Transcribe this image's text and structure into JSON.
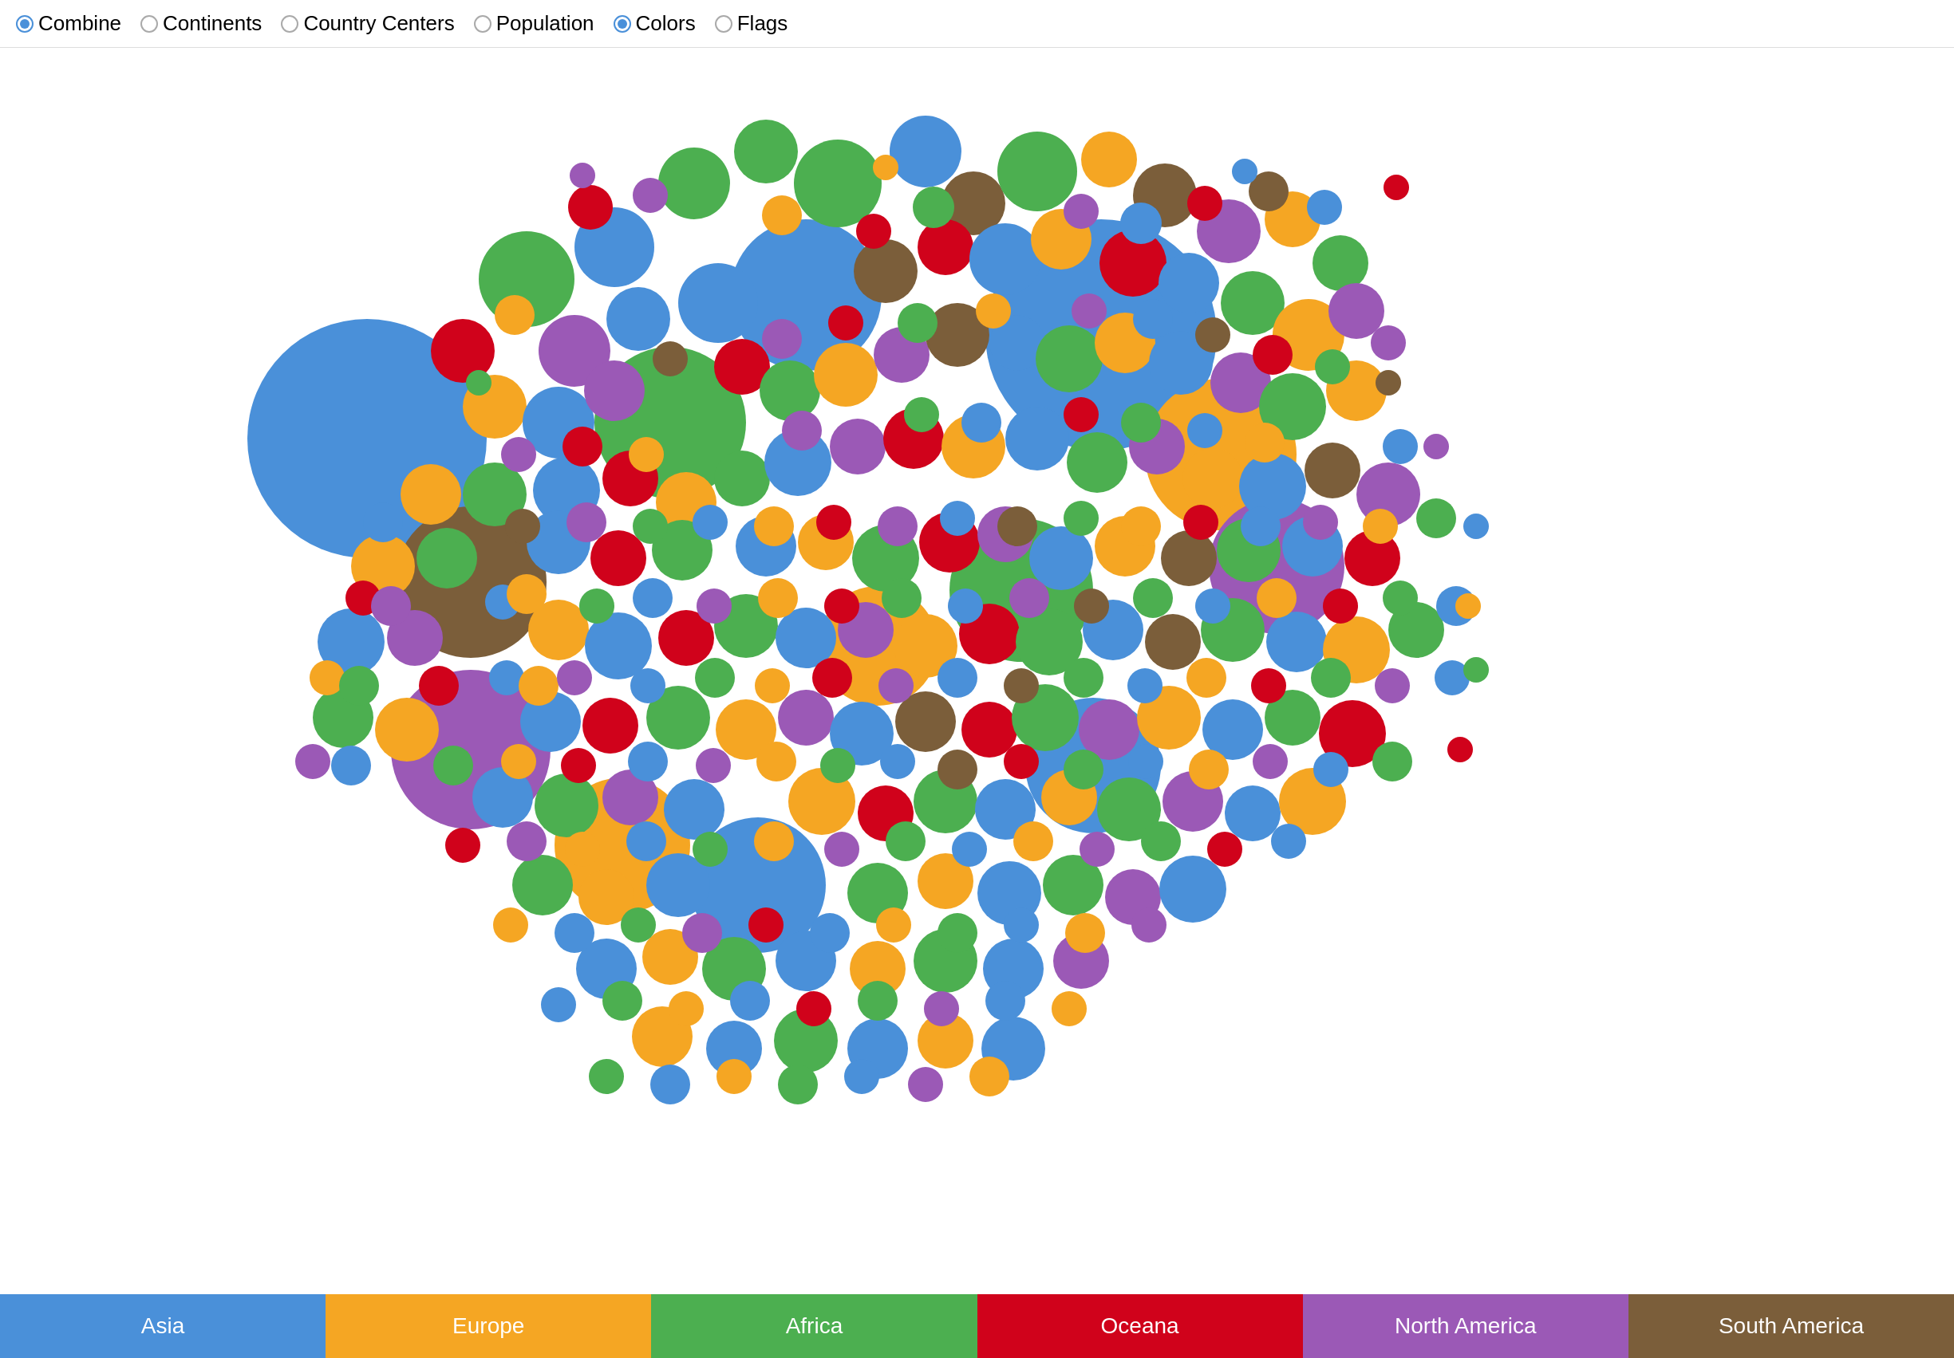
{
  "toolbar": {
    "options": [
      {
        "label": "Combine",
        "checked": true,
        "id": "combine"
      },
      {
        "label": "Continents",
        "checked": false,
        "id": "continents"
      },
      {
        "label": "Country Centers",
        "checked": false,
        "id": "country-centers"
      },
      {
        "label": "Population",
        "checked": false,
        "id": "population"
      },
      {
        "label": "Colors",
        "checked": true,
        "id": "colors"
      },
      {
        "label": "Flags",
        "checked": false,
        "id": "flags"
      }
    ]
  },
  "legend": {
    "items": [
      {
        "label": "Asia",
        "color": "#4A90D9"
      },
      {
        "label": "Europe",
        "color": "#F5A623"
      },
      {
        "label": "Africa",
        "color": "#4CAF50"
      },
      {
        "label": "Oceana",
        "color": "#D0021B"
      },
      {
        "label": "North America",
        "color": "#9B59B6"
      },
      {
        "label": "South America",
        "color": "#7B5E3A"
      }
    ]
  }
}
